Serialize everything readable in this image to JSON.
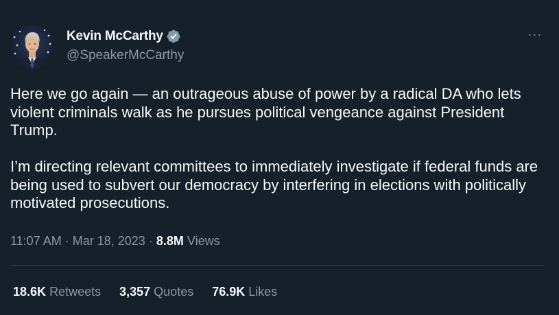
{
  "author": {
    "display_name": "Kevin McCarthy",
    "handle": "@SpeakerMcCarthy",
    "verified": true,
    "avatar_icon": "profile-photo",
    "verified_icon": "verified-badge-icon",
    "verified_color": "#829aab"
  },
  "menu": {
    "more_label": "···"
  },
  "tweet": {
    "paragraphs": [
      "Here we go again — an outrageous abuse of power by a radical DA who lets violent criminals walk as he pursues political vengeance against President Trump.",
      "I’m directing relevant committees to immediately investigate if federal funds are being used to subvert our democracy by interfering in elections with politically motivated prosecutions."
    ],
    "time": "11:07 AM",
    "separator": "·",
    "date": "Mar 18, 2023",
    "views_count": "8.8M",
    "views_label": "Views"
  },
  "stats": {
    "retweets_count": "18.6K",
    "retweets_label": "Retweets",
    "quotes_count": "3,357",
    "quotes_label": "Quotes",
    "likes_count": "76.9K",
    "likes_label": "Likes"
  },
  "colors": {
    "background": "#15202b",
    "text": "#f7f9f9",
    "secondary": "#8b98a5",
    "divider": "#38444d"
  }
}
